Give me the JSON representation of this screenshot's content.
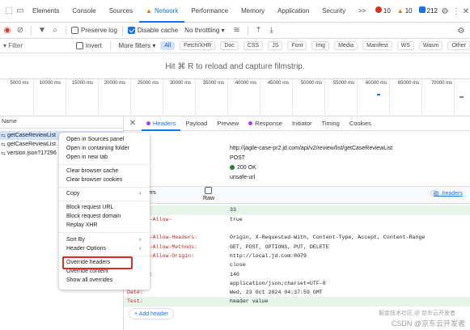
{
  "devtools": {
    "tabs": [
      "Elements",
      "Console",
      "Sources",
      "Network",
      "Performance",
      "Memory",
      "Application",
      "Security",
      ">>"
    ],
    "active_tab": "Network",
    "counts": {
      "errors": "10",
      "warnings": "10",
      "info": "212"
    }
  },
  "toolbar": {
    "preserve_log": "Preserve log",
    "disable_cache": "Disable cache",
    "throttling": "No throttling"
  },
  "filter": {
    "placeholder": "Filter",
    "invert": "Invert",
    "more_filters": "More filters",
    "chips": [
      "All",
      "Fetch/XHR",
      "Doc",
      "CSS",
      "JS",
      "Font",
      "Img",
      "Media",
      "Manifest",
      "WS",
      "Wasm",
      "Other"
    ]
  },
  "filmstrip": {
    "hint": "Hit ⌘ R to reload and capture filmstrip."
  },
  "timeline": {
    "ticks": [
      "5000 ms",
      "10000 ms",
      "15000 ms",
      "20000 ms",
      "25000 ms",
      "30000 ms",
      "35000 ms",
      "40000 ms",
      "45000 ms",
      "50000 ms",
      "55000 ms",
      "60000 ms",
      "65000 ms",
      "70000 ms"
    ]
  },
  "requests": {
    "header": "Name",
    "items": [
      {
        "name": "getCaseReviewList",
        "selected": true
      },
      {
        "name": "getCaseReviewList",
        "selected": false
      },
      {
        "name": "version.json?17296",
        "selected": false
      }
    ]
  },
  "detail_tabs": [
    "Headers",
    "Payload",
    "Preview",
    "Response",
    "Initiator",
    "Timing",
    "Cookies"
  ],
  "general": {
    "rows": [
      {
        "key": "URL:",
        "value": "http://jagile-case-pr2.jd.com/api/v2/review/list/getCaseReviewList"
      },
      {
        "key": "Method:",
        "value": "POST"
      },
      {
        "key": "ode:",
        "value": "200 OK"
      },
      {
        "key": "Policy:",
        "value": "unsafe-url"
      }
    ]
  },
  "response_headers": {
    "title": "se Headers",
    "raw": "Raw",
    "link": ".headers",
    "rows": [
      {
        "key": "",
        "value": "33",
        "highlight": true
      },
      {
        "key": "Control-Allow-",
        "value": "true"
      },
      {
        "key": "ials:",
        "value": ""
      },
      {
        "key": "Control-Allow-Headers:",
        "value": "Origin, X-Requested-With, Content-Type, Accept, Content-Range"
      },
      {
        "key": "Control-Allow-Methods:",
        "value": "GET, POST, OPTIONS, PUT, DELETE"
      },
      {
        "key": "Control-Allow-Origin:",
        "value": "http://local.jd.com:8079"
      },
      {
        "key": "ion:",
        "value": "close"
      },
      {
        "key": "-Length:",
        "value": "140"
      },
      {
        "key": "-Type:",
        "value": "application/json;charset=UTF-8"
      },
      {
        "key": "Date:",
        "value": "Wed, 23 Oct 2024 04:37:59 GMT"
      },
      {
        "key": "Test:",
        "value": "header value",
        "highlight": true
      }
    ],
    "add_header": "+ Add header"
  },
  "context_menu": {
    "items": [
      {
        "label": "Open in Sources panel"
      },
      {
        "label": "Open in containing folder"
      },
      {
        "label": "Open in new tab"
      },
      {
        "label": "Clear browser cache"
      },
      {
        "label": "Clear browser cookies"
      },
      {
        "label": "Copy",
        "submenu": true
      },
      {
        "label": "Block request URL"
      },
      {
        "label": "Block request domain"
      },
      {
        "label": "Replay XHR"
      },
      {
        "label": "Sort By",
        "submenu": true
      },
      {
        "label": "Header Options",
        "submenu": true
      },
      {
        "label": "Override headers"
      },
      {
        "label": "Override content"
      },
      {
        "label": "Show all overrides"
      }
    ]
  },
  "watermark": {
    "line1": "掘金技术社区 @ 京东云开发者",
    "line2": "CSDN @京东云开发者"
  },
  "colors": {
    "accent": "#1a73e8",
    "error": "#d93025",
    "warning": "#e37400",
    "success": "#188038"
  }
}
